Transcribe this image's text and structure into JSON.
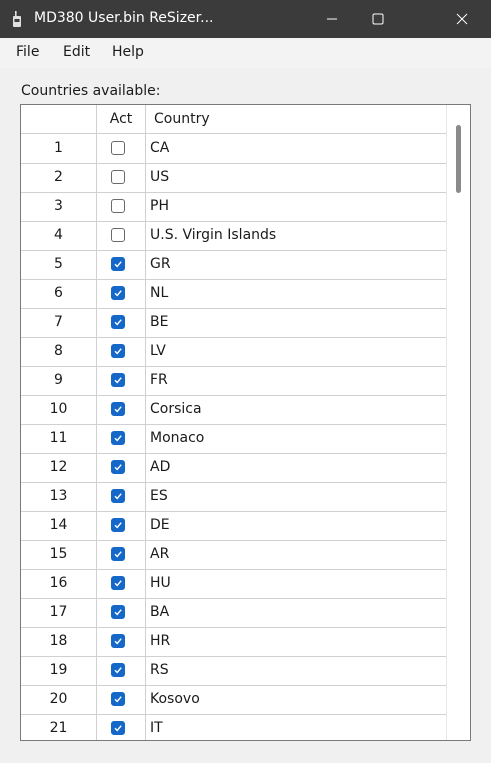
{
  "window": {
    "title": "MD380 User.bin ReSizer..."
  },
  "menu": [
    "File",
    "Edit",
    "Help"
  ],
  "countries_label": "Countries available:",
  "table": {
    "headers": {
      "index": "",
      "act": "Act",
      "country": "Country"
    },
    "rows": [
      {
        "n": "1",
        "act": false,
        "country": "CA"
      },
      {
        "n": "2",
        "act": false,
        "country": "US"
      },
      {
        "n": "3",
        "act": false,
        "country": "PH"
      },
      {
        "n": "4",
        "act": false,
        "country": "U.S. Virgin Islands"
      },
      {
        "n": "5",
        "act": true,
        "country": "GR"
      },
      {
        "n": "6",
        "act": true,
        "country": "NL"
      },
      {
        "n": "7",
        "act": true,
        "country": "BE"
      },
      {
        "n": "8",
        "act": true,
        "country": "LV"
      },
      {
        "n": "9",
        "act": true,
        "country": "FR"
      },
      {
        "n": "10",
        "act": true,
        "country": "Corsica"
      },
      {
        "n": "11",
        "act": true,
        "country": "Monaco"
      },
      {
        "n": "12",
        "act": true,
        "country": "AD"
      },
      {
        "n": "13",
        "act": true,
        "country": "ES"
      },
      {
        "n": "14",
        "act": true,
        "country": "DE"
      },
      {
        "n": "15",
        "act": true,
        "country": "AR"
      },
      {
        "n": "16",
        "act": true,
        "country": "HU"
      },
      {
        "n": "17",
        "act": true,
        "country": "BA"
      },
      {
        "n": "18",
        "act": true,
        "country": "HR"
      },
      {
        "n": "19",
        "act": true,
        "country": "RS"
      },
      {
        "n": "20",
        "act": true,
        "country": "Kosovo"
      },
      {
        "n": "21",
        "act": true,
        "country": "IT"
      }
    ]
  },
  "colors": {
    "accent": "#1567c8",
    "titlebar": "#3b3b3b"
  },
  "icons": {
    "app": "radio-icon",
    "minimize": "minimize-icon",
    "maximize": "maximize-icon",
    "close": "close-icon"
  }
}
